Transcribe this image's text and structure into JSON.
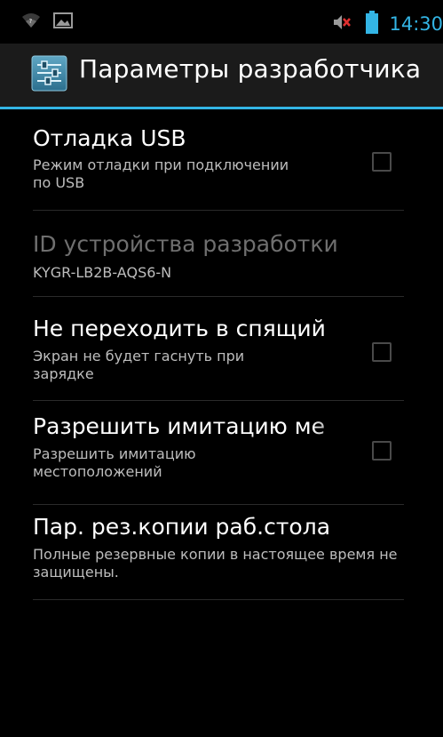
{
  "status_bar": {
    "time": "14:30",
    "icons": [
      "wifi-icon",
      "image-notification-icon",
      "mute-icon",
      "battery-icon"
    ],
    "accent_color": "#33b5e5"
  },
  "action_bar": {
    "title": "Параметры разработчика",
    "icon": "developer-settings-icon"
  },
  "items": [
    {
      "title": "Отладка USB",
      "subtitle": "Режим отладки при подключении по USB",
      "has_checkbox": true,
      "checked": false,
      "enabled": true
    },
    {
      "title": "ID устройства разработки",
      "subtitle": "KYGR-LB2B-AQS6-N",
      "has_checkbox": false,
      "enabled": false
    },
    {
      "title": "Не переходить в спящий",
      "subtitle": "Экран не будет гаснуть при зарядке",
      "has_checkbox": true,
      "checked": false,
      "enabled": true
    },
    {
      "title": "Разрешить имитацию ме",
      "subtitle": "Разрешить имитацию местоположений",
      "has_checkbox": true,
      "checked": false,
      "enabled": true
    },
    {
      "title": "Пар. рез.копии раб.стола",
      "subtitle": "Полные резервные копии в настоящее время не защищены.",
      "has_checkbox": false,
      "enabled": true
    }
  ]
}
